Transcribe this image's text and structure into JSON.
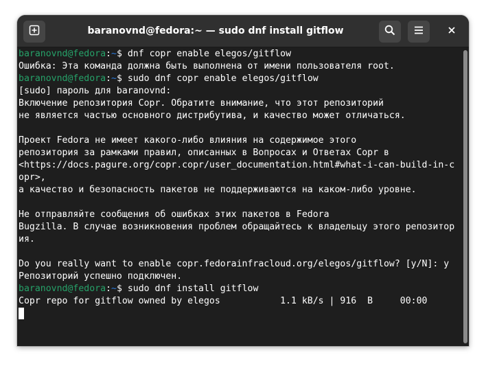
{
  "window": {
    "title": "baranovnd@fedora:~ — sudo dnf install gitflow"
  },
  "headerbar": {
    "new_tab_icon": "new-tab-icon",
    "search_icon": "search-icon",
    "menu_icon": "hamburger-menu-icon",
    "close_icon": "close-icon"
  },
  "colors": {
    "prompt_user": "#26a269",
    "prompt_path": "#2a7bde",
    "terminal_bg": "#1e1e1e",
    "headerbar_bg": "#303030"
  },
  "terminal": {
    "lines": [
      {
        "type": "prompt",
        "user": "baranovnd@fedora",
        "sep": ":",
        "path": "~",
        "cmd": "$ dnf copr enable elegos/gitflow"
      },
      {
        "type": "text",
        "text": "Ошибка: Эта команда должна быть выполнена от имени пользователя root."
      },
      {
        "type": "prompt",
        "user": "baranovnd@fedora",
        "sep": ":",
        "path": "~",
        "cmd": "$ sudo dnf copr enable elegos/gitflow"
      },
      {
        "type": "text",
        "text": "[sudo] пароль для baranovnd:"
      },
      {
        "type": "text",
        "text": "Включение репозитория Copr. Обратите внимание, что этот репозиторий"
      },
      {
        "type": "text",
        "text": "не является частью основного дистрибутива, и качество может отличаться."
      },
      {
        "type": "text",
        "text": ""
      },
      {
        "type": "text",
        "text": "Проект Fedora не имеет какого-либо влияния на содержимое этого"
      },
      {
        "type": "text",
        "text": "репозитория за рамками правил, описанных в Вопросах и Ответах Copr в"
      },
      {
        "type": "text",
        "text": "<https://docs.pagure.org/copr.copr/user_documentation.html#what-i-can-build-in-c"
      },
      {
        "type": "text",
        "text": "opr>,"
      },
      {
        "type": "text",
        "text": "а качество и безопасность пакетов не поддерживаются на каком-либо уровне."
      },
      {
        "type": "text",
        "text": ""
      },
      {
        "type": "text",
        "text": "Не отправляйте сообщения об ошибках этих пакетов в Fedora"
      },
      {
        "type": "text",
        "text": "Bugzilla. В случае возникновения проблем обращайтесь к владельцу этого репозитор"
      },
      {
        "type": "text",
        "text": "ия."
      },
      {
        "type": "text",
        "text": ""
      },
      {
        "type": "text",
        "text": "Do you really want to enable copr.fedorainfracloud.org/elegos/gitflow? [y/N]: y"
      },
      {
        "type": "text",
        "text": "Репозиторий успешно подключен."
      },
      {
        "type": "prompt",
        "user": "baranovnd@fedora",
        "sep": ":",
        "path": "~",
        "cmd": "$ sudo dnf install gitflow"
      },
      {
        "type": "text",
        "text": "Copr repo for gitflow owned by elegos           1.1 kB/s | 916  B     00:00"
      },
      {
        "type": "cursor"
      }
    ]
  }
}
